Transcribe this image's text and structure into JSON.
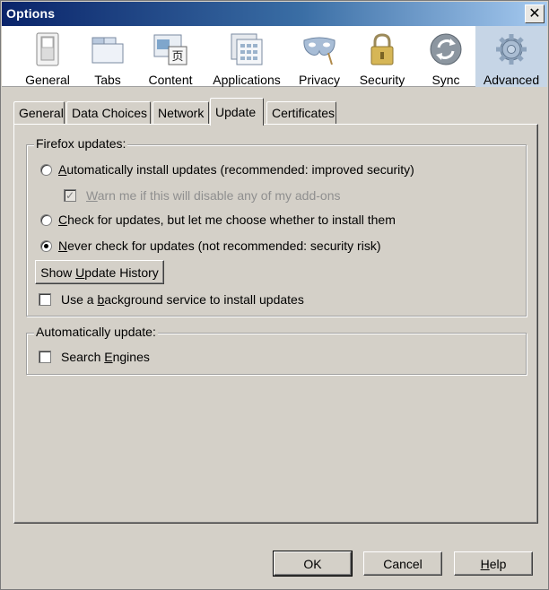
{
  "window": {
    "title": "Options",
    "close_symbol": "✕"
  },
  "toolbar": {
    "panes": [
      {
        "label": "General",
        "icon": "general-switch-icon"
      },
      {
        "label": "Tabs",
        "icon": "tabs-icon"
      },
      {
        "label": "Content",
        "icon": "content-icon"
      },
      {
        "label": "Applications",
        "icon": "applications-icon"
      },
      {
        "label": "Privacy",
        "icon": "privacy-mask-icon"
      },
      {
        "label": "Security",
        "icon": "padlock-icon"
      },
      {
        "label": "Sync",
        "icon": "sync-icon"
      },
      {
        "label": "Advanced",
        "icon": "gear-icon"
      }
    ],
    "selected": "Advanced"
  },
  "tabs": [
    {
      "label": "General"
    },
    {
      "label": "Data Choices"
    },
    {
      "label": "Network"
    },
    {
      "label": "Update"
    },
    {
      "label": "Certificates"
    }
  ],
  "active_tab": "Update",
  "firefox_updates": {
    "legend": "Firefox updates:",
    "options": [
      {
        "pre": "",
        "key": "A",
        "post": "utomatically install updates (recommended: improved security)",
        "checked": false
      },
      {
        "pre": "",
        "key": "C",
        "post": "heck for updates, but let me choose whether to install them",
        "checked": false
      },
      {
        "pre": "",
        "key": "N",
        "post": "ever check for updates (not recommended: security risk)",
        "checked": true
      }
    ],
    "warn": {
      "pre": "",
      "key": "W",
      "post": "arn me if this will disable any of my add-ons",
      "checked": true,
      "disabled": true
    },
    "history_button": {
      "pre": "Show ",
      "key": "U",
      "post": "pdate History"
    },
    "background": {
      "pre": "Use a ",
      "key": "b",
      "post": "ackground service to install updates",
      "checked": false
    }
  },
  "auto_update": {
    "legend": "Automatically update:",
    "search_engines": {
      "pre": "Search ",
      "key": "E",
      "post": "ngines",
      "checked": false
    }
  },
  "buttons": {
    "ok": "OK",
    "cancel": "Cancel",
    "help": {
      "pre": "",
      "key": "H",
      "post": "elp"
    }
  },
  "colors": {
    "titlebar_start": "#0a246a",
    "selected_pane": "#c6d5e6",
    "dialog_bg": "#d4d0c8"
  }
}
